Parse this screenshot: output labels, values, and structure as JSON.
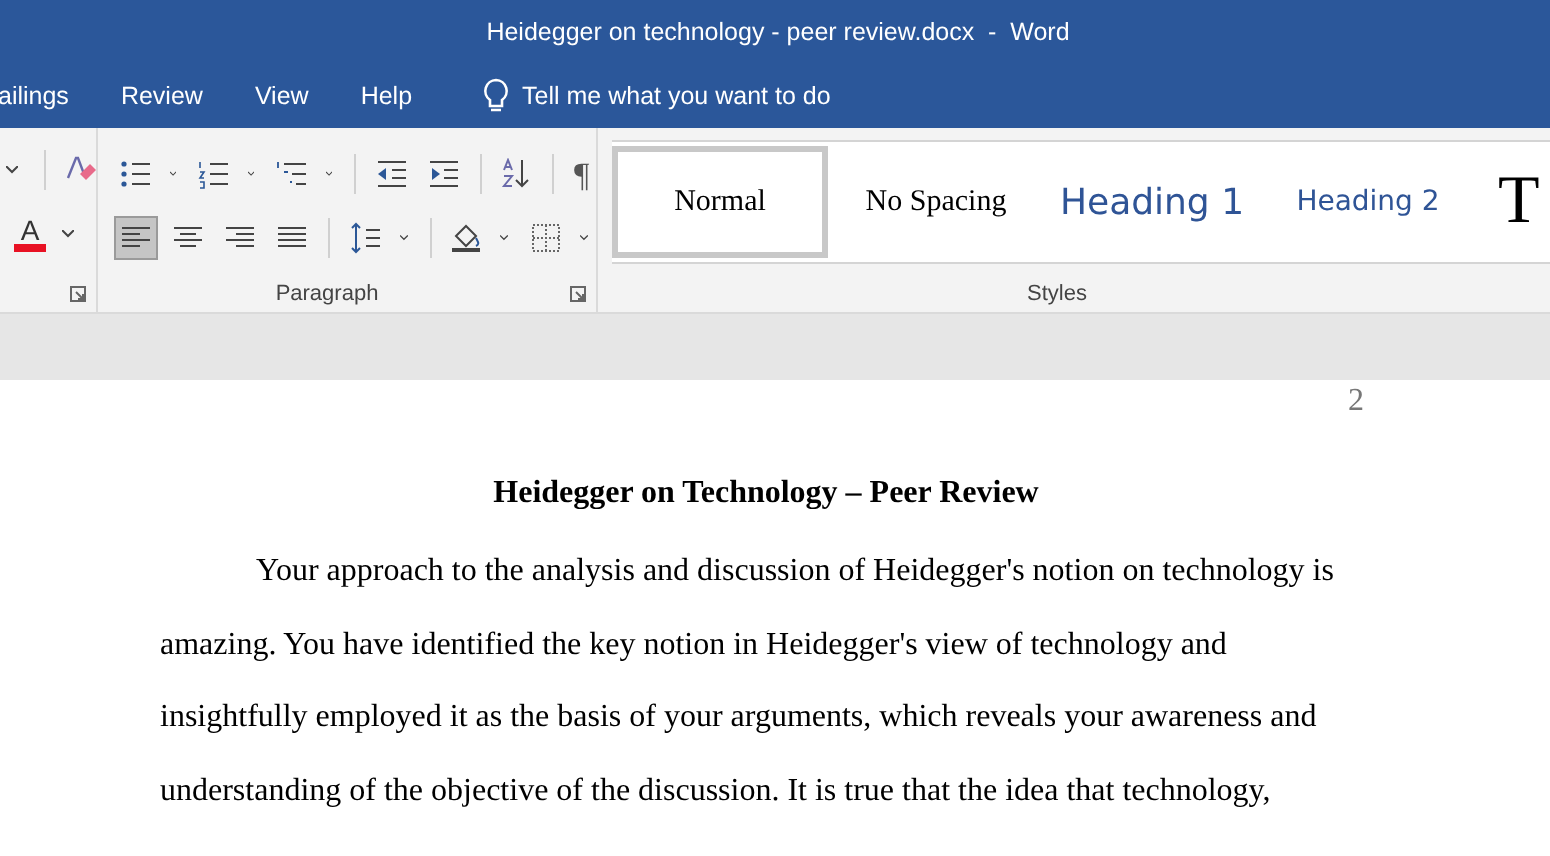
{
  "window": {
    "title": "Heidegger on technology - peer review.docx  -  Word"
  },
  "tabs": [
    {
      "label": "ailings",
      "selected": false
    },
    {
      "label": "Review",
      "selected": false
    },
    {
      "label": "View",
      "selected": false
    },
    {
      "label": "Help",
      "selected": false
    }
  ],
  "tell_me": {
    "placeholder": "Tell me what you want to do"
  },
  "font_group": {
    "font_color_glyph": "A"
  },
  "paragraph_group": {
    "label": "Paragraph",
    "rows": [
      [
        {
          "kind": "bullets",
          "dropdown": true,
          "selected": false
        },
        {
          "kind": "numbering",
          "dropdown": true,
          "selected": false
        },
        {
          "kind": "multilevel",
          "dropdown": true,
          "selected": false
        },
        {
          "kind": "sep"
        },
        {
          "kind": "outdent",
          "selected": false
        },
        {
          "kind": "indent",
          "selected": false
        },
        {
          "kind": "sep"
        },
        {
          "kind": "sort",
          "selected": false
        },
        {
          "kind": "sep"
        },
        {
          "kind": "pilcrow",
          "glyph": "¶",
          "selected": false
        }
      ],
      [
        {
          "kind": "align-left",
          "selected": true
        },
        {
          "kind": "align-center",
          "selected": false
        },
        {
          "kind": "align-right",
          "selected": false
        },
        {
          "kind": "justify",
          "selected": false
        },
        {
          "kind": "sep"
        },
        {
          "kind": "line-spacing",
          "dropdown": true,
          "selected": false
        },
        {
          "kind": "sep"
        },
        {
          "kind": "shading",
          "dropdown": true,
          "selected": false
        },
        {
          "kind": "borders",
          "dropdown": true,
          "selected": false
        }
      ]
    ]
  },
  "styles_group": {
    "label": "Styles",
    "items": [
      {
        "label": "Normal",
        "kind": "serif",
        "selected": true
      },
      {
        "label": "No Spacing",
        "kind": "serif",
        "selected": false
      },
      {
        "label": "Heading 1",
        "kind": "heading1",
        "selected": false
      },
      {
        "label": "Heading 2",
        "kind": "heading2",
        "selected": false
      },
      {
        "label": "T",
        "kind": "title",
        "selected": false
      }
    ]
  },
  "document": {
    "page_number": "2",
    "heading": "Heidegger on Technology – Peer Review",
    "paragraph": "Your approach to the analysis and discussion of Heidegger's notion on technology is amazing. You have identified the key notion in Heidegger's view of technology and insightfully employed it as the basis of your arguments, which reveals your awareness and understanding of the objective of the discussion. It is true that the idea that technology,"
  }
}
